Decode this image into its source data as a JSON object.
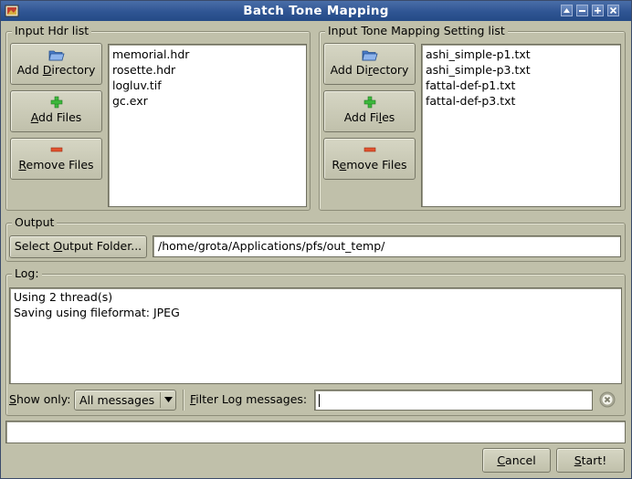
{
  "window": {
    "title": "Batch Tone Mapping"
  },
  "input_hdr": {
    "group_label": "Input Hdr list",
    "add_directory": {
      "pre": "Add ",
      "u": "D",
      "post": "irectory"
    },
    "add_files": {
      "pre": "",
      "u": "A",
      "post": "dd Files"
    },
    "remove_files": {
      "pre": "",
      "u": "R",
      "post": "emove Files"
    },
    "files": [
      "memorial.hdr",
      "rosette.hdr",
      "logluv.tif",
      "gc.exr"
    ]
  },
  "input_tm": {
    "group_label": "Input Tone Mapping Setting list",
    "add_directory": {
      "pre": "Add Di",
      "u": "r",
      "post": "ectory"
    },
    "add_files": {
      "pre": "Add Fi",
      "u": "l",
      "post": "es"
    },
    "remove_files": {
      "pre": "R",
      "u": "e",
      "post": "move Files"
    },
    "files": [
      "ashi_simple-p1.txt",
      "ashi_simple-p3.txt",
      "fattal-def-p1.txt",
      "fattal-def-p3.txt"
    ]
  },
  "output": {
    "group_label": "Output",
    "select_folder": {
      "pre": "Select ",
      "u": "O",
      "post": "utput Folder..."
    },
    "path": "/home/grota/Applications/pfs/out_temp/"
  },
  "log": {
    "group_label": "Log:",
    "lines": [
      "Using 2 thread(s)",
      "Saving using fileformat: JPEG"
    ],
    "show_only": {
      "pre": "",
      "u": "S",
      "post": "how only:"
    },
    "show_only_value": "All messages",
    "filter": {
      "pre": "",
      "u": "F",
      "post": "ilter Log messages:"
    },
    "filter_value": ""
  },
  "status_bar": {
    "text": ""
  },
  "footer": {
    "cancel": {
      "pre": "",
      "u": "C",
      "post": "ancel"
    },
    "start": {
      "pre": "",
      "u": "S",
      "post": "tart!"
    }
  }
}
